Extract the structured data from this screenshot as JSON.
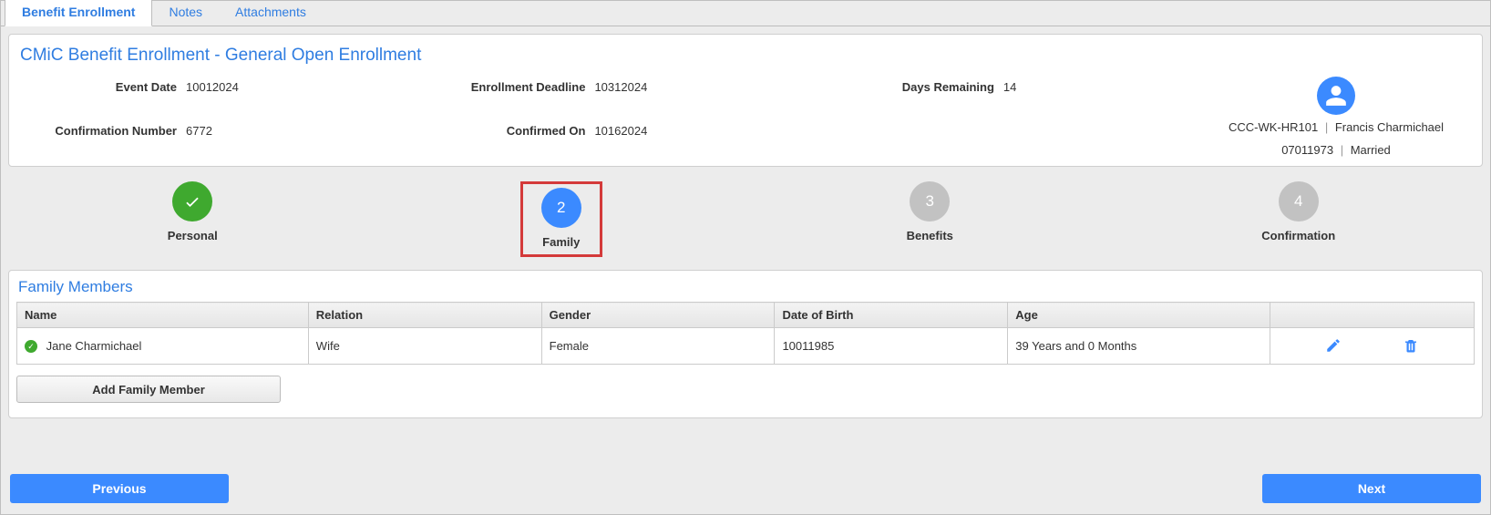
{
  "tabs": {
    "benefit_enrollment": "Benefit Enrollment",
    "notes": "Notes",
    "attachments": "Attachments"
  },
  "header": {
    "title": "CMiC Benefit Enrollment - General Open Enrollment",
    "labels": {
      "event_date": "Event Date",
      "enrollment_deadline": "Enrollment Deadline",
      "days_remaining": "Days Remaining",
      "confirmation_number": "Confirmation Number",
      "confirmed_on": "Confirmed On"
    },
    "values": {
      "event_date": "10012024",
      "enrollment_deadline": "10312024",
      "days_remaining": "14",
      "confirmation_number": "6772",
      "confirmed_on": "10162024"
    },
    "person": {
      "code": "CCC-WK-HR101",
      "name": "Francis Charmichael",
      "dob": "07011973",
      "marital_status": "Married"
    }
  },
  "steps": {
    "s1": "Personal",
    "s2": "Family",
    "s3": "Benefits",
    "s4": "Confirmation",
    "n2": "2",
    "n3": "3",
    "n4": "4"
  },
  "family": {
    "section_title": "Family Members",
    "columns": {
      "name": "Name",
      "relation": "Relation",
      "gender": "Gender",
      "dob": "Date of Birth",
      "age": "Age"
    },
    "rows": [
      {
        "name": "Jane Charmichael",
        "relation": "Wife",
        "gender": "Female",
        "dob": "10011985",
        "age": "39 Years and 0 Months"
      }
    ],
    "add_button": "Add Family Member"
  },
  "footer": {
    "prev": "Previous",
    "next": "Next"
  }
}
